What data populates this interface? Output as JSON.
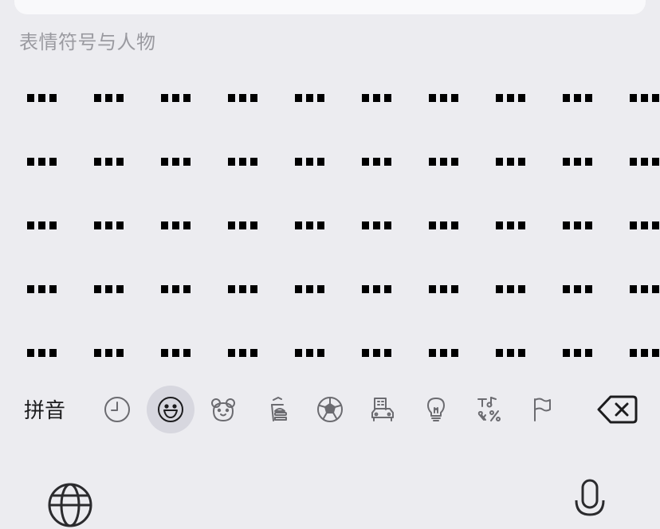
{
  "section_title": "表情符号与人物",
  "emoji_grid": {
    "rows": 5,
    "columns": 10,
    "placeholder_glyph": "▪▪▪"
  },
  "bottom_bar": {
    "pinyin_label": "拼音",
    "categories": [
      {
        "name": "recent",
        "icon": "clock-icon",
        "active": false
      },
      {
        "name": "smileys",
        "icon": "smiley-icon",
        "active": true
      },
      {
        "name": "animals",
        "icon": "bear-icon",
        "active": false
      },
      {
        "name": "food",
        "icon": "food-icon",
        "active": false
      },
      {
        "name": "activity",
        "icon": "soccer-ball-icon",
        "active": false
      },
      {
        "name": "travel",
        "icon": "car-building-icon",
        "active": false
      },
      {
        "name": "objects",
        "icon": "lightbulb-icon",
        "active": false
      },
      {
        "name": "symbols",
        "icon": "symbols-icon",
        "active": false
      },
      {
        "name": "flags",
        "icon": "flag-icon",
        "active": false
      }
    ],
    "delete_icon": "delete-icon"
  },
  "system_row": {
    "globe_icon": "globe-icon",
    "mic_icon": "microphone-icon"
  },
  "colors": {
    "background": "#ececf0",
    "active_category_bg": "#d7d7df",
    "section_title": "#9a9aa0"
  }
}
